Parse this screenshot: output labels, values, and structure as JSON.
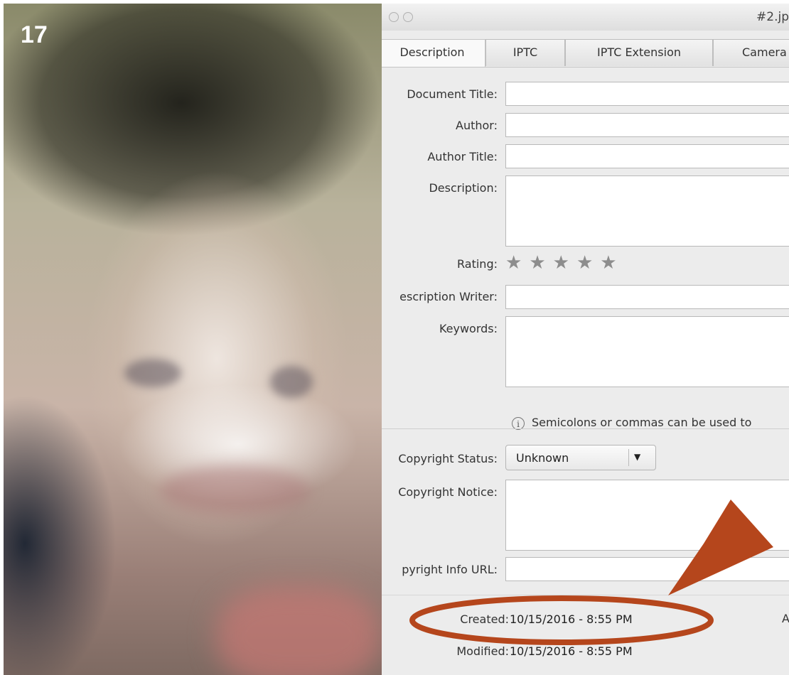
{
  "slide": {
    "number": "17"
  },
  "window": {
    "title": "#2.jp",
    "controls": [
      "close",
      "minimize"
    ]
  },
  "tabs": [
    {
      "label": "Description",
      "active": true
    },
    {
      "label": "IPTC",
      "active": false
    },
    {
      "label": "IPTC Extension",
      "active": false
    },
    {
      "label": "Camera",
      "active": false
    }
  ],
  "form": {
    "document_title": {
      "label": "Document Title:",
      "value": ""
    },
    "author": {
      "label": "Author:",
      "value": ""
    },
    "author_title": {
      "label": "Author Title:",
      "value": ""
    },
    "description": {
      "label": "Description:",
      "value": ""
    },
    "rating": {
      "label": "Rating:",
      "value": 0,
      "max": 5,
      "icon": "star-icon"
    },
    "description_writer": {
      "label": "escription Writer:",
      "value": ""
    },
    "keywords": {
      "label": "Keywords:",
      "value": ""
    },
    "keywords_hint": "Semicolons or commas can be used to",
    "copyright_status": {
      "label": "Copyright Status:",
      "value": "Unknown"
    },
    "copyright_notice": {
      "label": "Copyright Notice:",
      "value": ""
    },
    "copyright_info_url": {
      "label": "pyright Info URL:",
      "value": ""
    }
  },
  "metadata": {
    "created": {
      "label": "Created:",
      "value": "10/15/2016 - 8:55 PM"
    },
    "modified": {
      "label": "Modified:",
      "value": "10/15/2016 - 8:55 PM"
    },
    "trailing": "A"
  },
  "annotation": {
    "color": "#b5461c",
    "highlight_target": "created-date",
    "shapes": [
      "ellipse",
      "arrow"
    ]
  }
}
